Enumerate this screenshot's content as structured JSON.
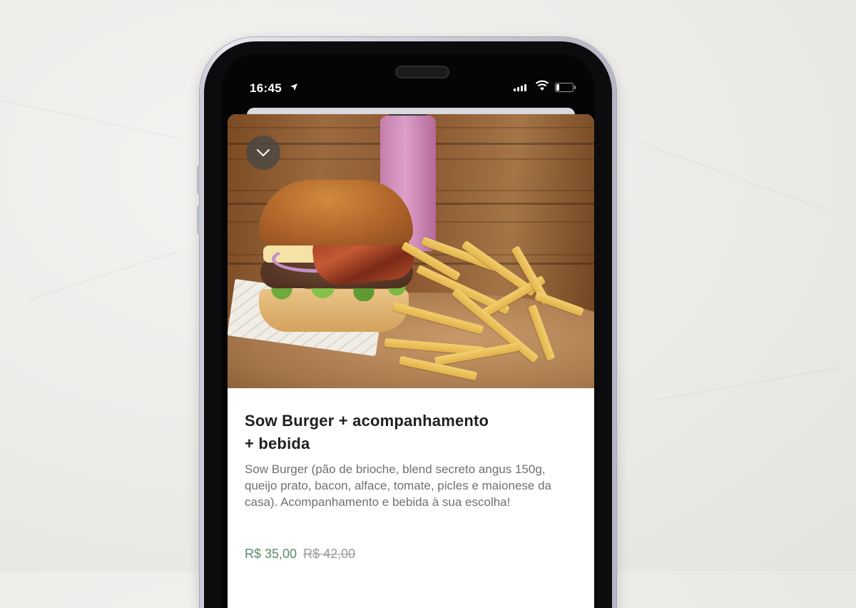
{
  "status_bar": {
    "time": "16:45",
    "icons": [
      "location-arrow-icon",
      "signal-icon",
      "wifi-icon",
      "battery-icon"
    ]
  },
  "product": {
    "title_line1": "Sow Burger + acompanhamento",
    "title_line2": "+ bebida",
    "description": "Sow Burger (pão de brioche, blend secreto angus 150g, queijo prato, bacon, alface, tomate, picles e maionese da casa). Acompanhamento e bebida à sua escolha!",
    "price_current": "R$ 35,00",
    "price_original": "R$ 42,00",
    "image": "burger-fries-drink-photo"
  },
  "controls": {
    "collapse_icon": "chevron-down-icon"
  },
  "colors": {
    "price_current": "#5a8a6a",
    "price_original": "#9a9a9a",
    "title": "#1f1f1f",
    "description": "#707070"
  }
}
